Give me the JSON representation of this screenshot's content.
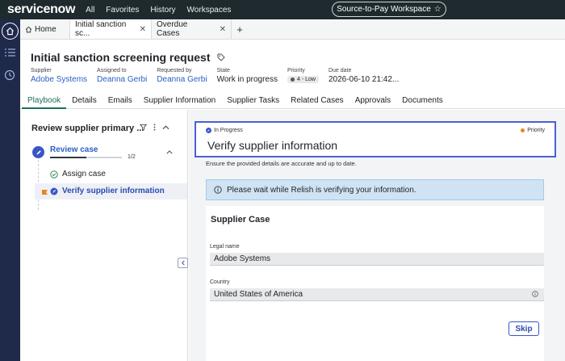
{
  "topbar": {
    "logo": "servicenow",
    "nav": [
      "All",
      "Favorites",
      "History",
      "Workspaces"
    ],
    "workspace_button": "Source-to-Pay Workspace"
  },
  "tabs": [
    {
      "label": "Home",
      "icon": "home-icon"
    },
    {
      "label": "Initial sanction sc...",
      "closable": true,
      "active": true
    },
    {
      "label": "Overdue Cases",
      "closable": true
    }
  ],
  "record": {
    "title": "Initial sanction screening request",
    "fields": [
      {
        "label": "Supplier",
        "value": "Adobe Systems",
        "link": true
      },
      {
        "label": "Assigned to",
        "value": "Deanna Gerbi",
        "link": true
      },
      {
        "label": "Requested by",
        "value": "Deanna Gerbi",
        "link": true
      },
      {
        "label": "State",
        "value": "Work in progress"
      },
      {
        "label": "Priority",
        "value": "4 - Low"
      },
      {
        "label": "Due date",
        "value": "2026-06-10 21:42..."
      }
    ]
  },
  "subtabs": [
    "Playbook",
    "Details",
    "Emails",
    "Supplier Information",
    "Supplier Tasks",
    "Related Cases",
    "Approvals",
    "Documents"
  ],
  "playbook": {
    "title": "Review supplier primary ...",
    "step": {
      "name": "Review case",
      "progress_text": "1/2",
      "progress": 0.5
    },
    "tasks": [
      {
        "label": "Assign case",
        "status": "complete"
      },
      {
        "label": "Verify supplier information",
        "status": "in-progress",
        "selected": true
      }
    ]
  },
  "task_card": {
    "status": "In Progress",
    "priority_label": "Priority",
    "title": "Verify supplier information",
    "description": "Ensure the provided details are accurate and up to date.",
    "banner": "Please wait while Relish is verifying your information."
  },
  "supplier_case": {
    "title": "Supplier Case",
    "legal_name_label": "Legal name",
    "legal_name_value": "Adobe Systems",
    "country_label": "Country",
    "country_value": "United States of America",
    "skip_label": "Skip"
  },
  "colors": {
    "topbar": "#1f2a2e",
    "rail": "#1f2a4a",
    "accent": "#3a55c8",
    "link": "#2a5fc4",
    "playbook_tab": "#1f6f5a",
    "banner": "#cfe3f4",
    "priority_dot": "#e8861b"
  }
}
